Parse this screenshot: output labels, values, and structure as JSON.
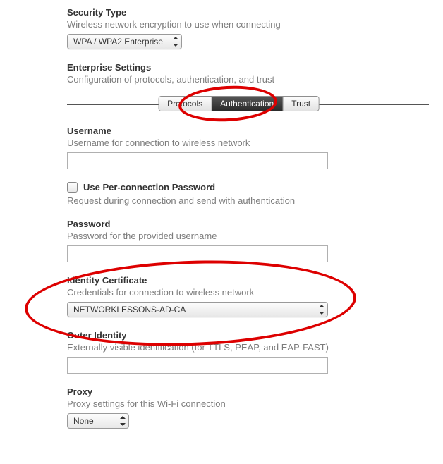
{
  "securityType": {
    "title": "Security Type",
    "desc": "Wireless network encryption to use when connecting",
    "value": "WPA / WPA2 Enterprise"
  },
  "enterprise": {
    "title": "Enterprise Settings",
    "desc": "Configuration of protocols, authentication, and trust",
    "tabs": {
      "protocols": "Protocols",
      "authentication": "Authentication",
      "trust": "Trust"
    }
  },
  "username": {
    "title": "Username",
    "desc": "Username for connection to wireless network",
    "value": ""
  },
  "perConnection": {
    "label": "Use Per-connection Password",
    "desc": "Request during connection and send with authentication"
  },
  "password": {
    "title": "Password",
    "desc": "Password for the provided username",
    "value": ""
  },
  "identityCert": {
    "title": "Identity Certificate",
    "desc": "Credentials for connection to wireless network",
    "value": "NETWORKLESSONS-AD-CA"
  },
  "outerIdentity": {
    "title": "Outer Identity",
    "desc": "Externally visible identification (for TTLS, PEAP, and EAP-FAST)",
    "value": ""
  },
  "proxy": {
    "title": "Proxy",
    "desc": "Proxy settings for this Wi-Fi connection",
    "value": "None"
  }
}
